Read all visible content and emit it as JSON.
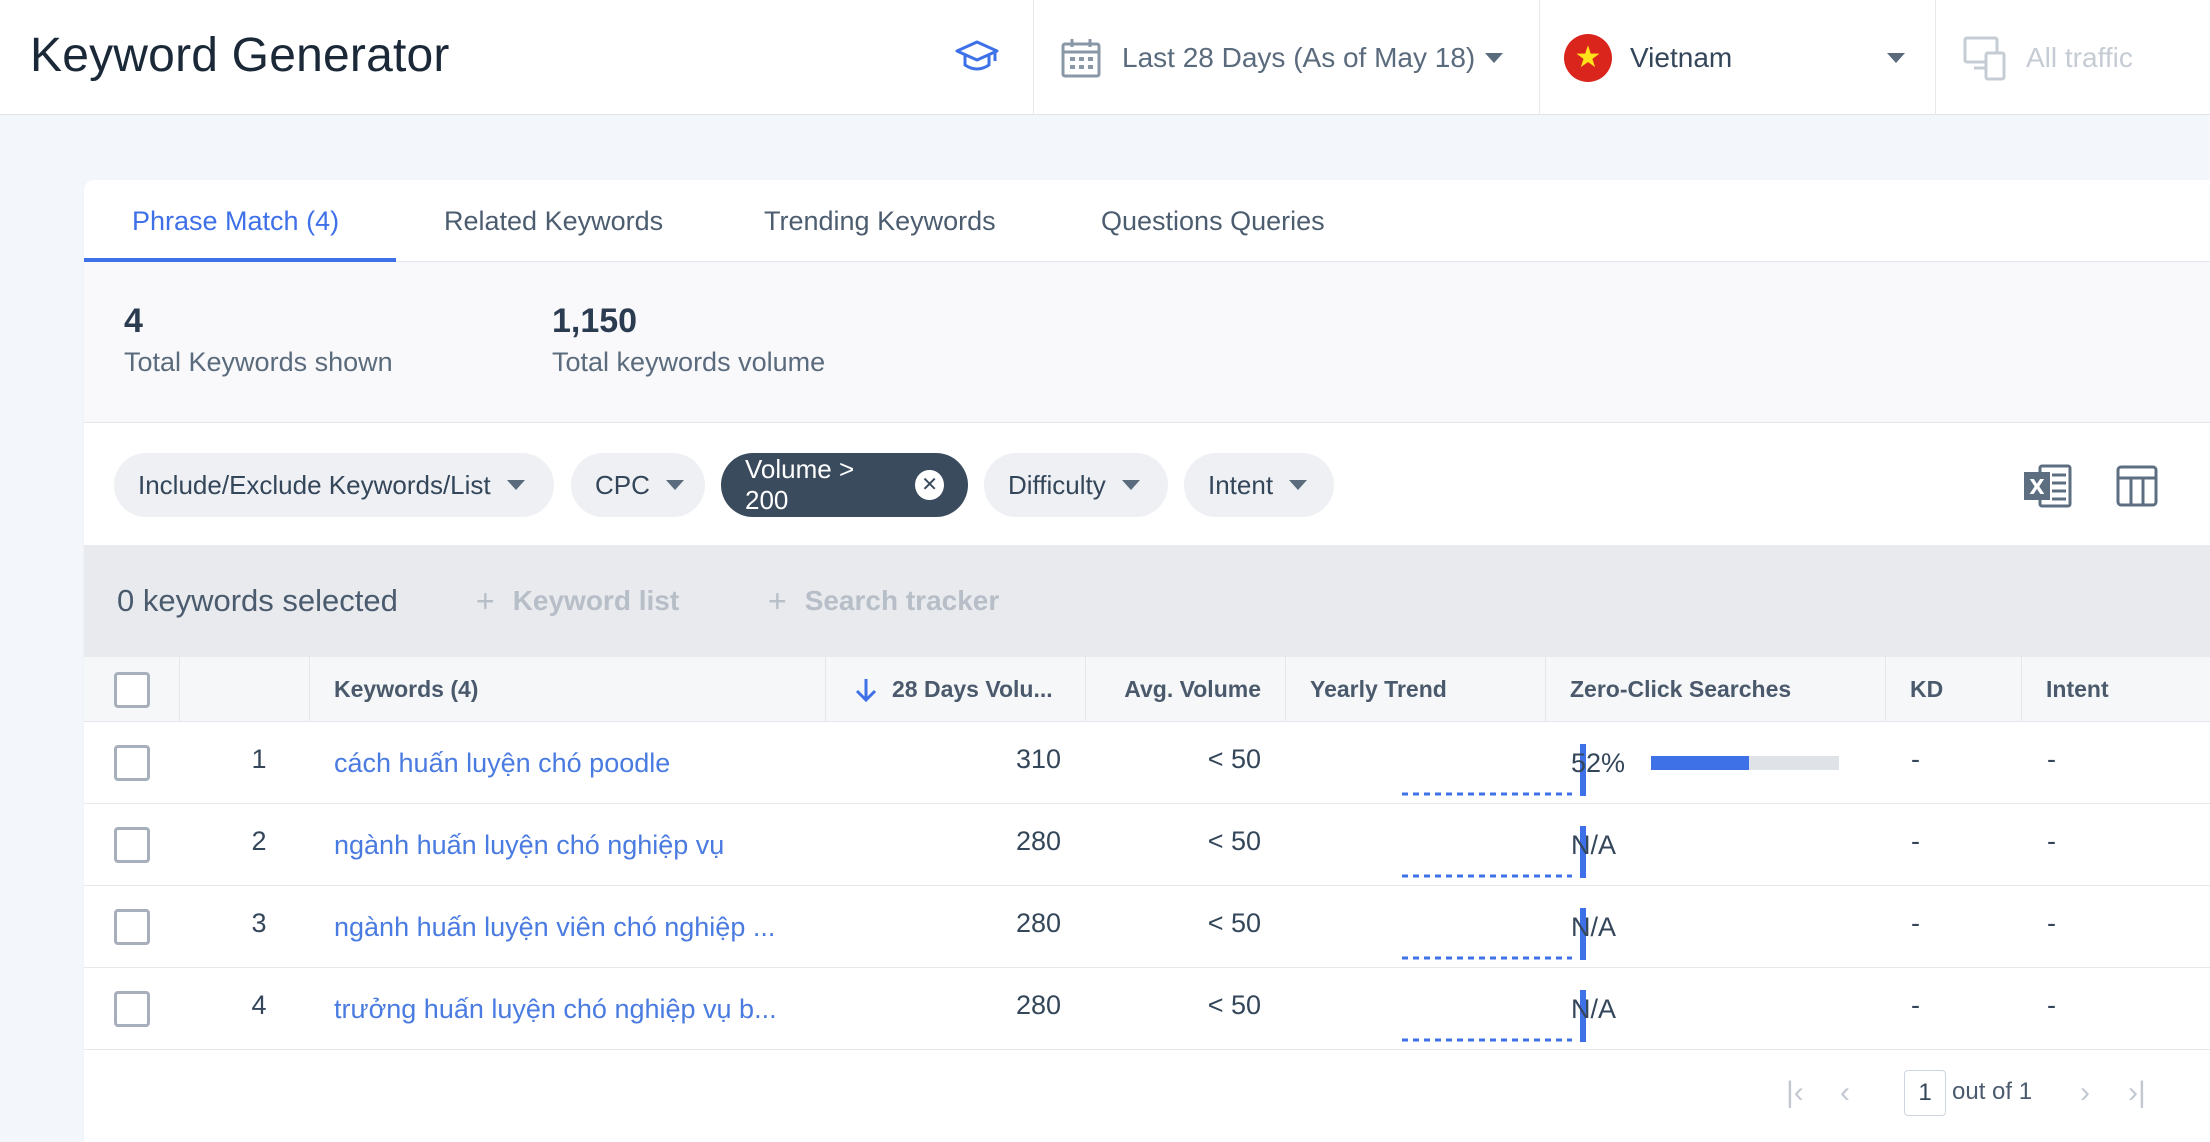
{
  "header": {
    "title": "Keyword Generator",
    "academy_icon": "graduation-cap-icon",
    "date_range": "Last 28 Days (As of May 18)",
    "country": "Vietnam",
    "traffic": "All traffic"
  },
  "tabs": [
    {
      "label": "Phrase Match (4)",
      "active": true
    },
    {
      "label": "Related Keywords",
      "active": false
    },
    {
      "label": "Trending Keywords",
      "active": false
    },
    {
      "label": "Questions Queries",
      "active": false
    }
  ],
  "summary": {
    "total_keywords": "4",
    "total_keywords_label": "Total Keywords shown",
    "total_volume": "1,150",
    "total_volume_label": "Total keywords volume"
  },
  "filters": {
    "include_exclude": "Include/Exclude Keywords/List",
    "cpc": "CPC",
    "volume": "Volume > 200",
    "difficulty": "Difficulty",
    "intent": "Intent"
  },
  "selection": {
    "count_label": "0 keywords selected",
    "keyword_list": "Keyword list",
    "search_tracker": "Search tracker"
  },
  "table": {
    "columns": {
      "keywords": "Keywords (4)",
      "volume": "28 Days Volu...",
      "avg_volume": "Avg. Volume",
      "yearly_trend": "Yearly Trend",
      "zero_click": "Zero-Click Searches",
      "kd": "KD",
      "intent": "Intent"
    },
    "rows": [
      {
        "num": "1",
        "keyword": "cách huấn luyện chó poodle",
        "volume": "310",
        "avg": "< 50",
        "zero_click": "52%",
        "zero_click_fraction": 0.52,
        "kd": "-",
        "intent": "-"
      },
      {
        "num": "2",
        "keyword": "ngành huấn luyện chó nghiệp vụ",
        "volume": "280",
        "avg": "< 50",
        "zero_click": "N/A",
        "zero_click_fraction": null,
        "kd": "-",
        "intent": "-"
      },
      {
        "num": "3",
        "keyword": "ngành huấn luyện viên chó nghiệp ...",
        "volume": "280",
        "avg": "< 50",
        "zero_click": "N/A",
        "zero_click_fraction": null,
        "kd": "-",
        "intent": "-"
      },
      {
        "num": "4",
        "keyword": "trưởng huấn luyện chó nghiệp vụ b...",
        "volume": "280",
        "avg": "< 50",
        "zero_click": "N/A",
        "zero_click_fraction": null,
        "kd": "-",
        "intent": "-"
      }
    ]
  },
  "pagination": {
    "page": "1",
    "of_label": "out of 1"
  },
  "colors": {
    "accent": "#3e70e8",
    "chip_dark": "#3a4b5e",
    "flag_red": "#da251d"
  }
}
